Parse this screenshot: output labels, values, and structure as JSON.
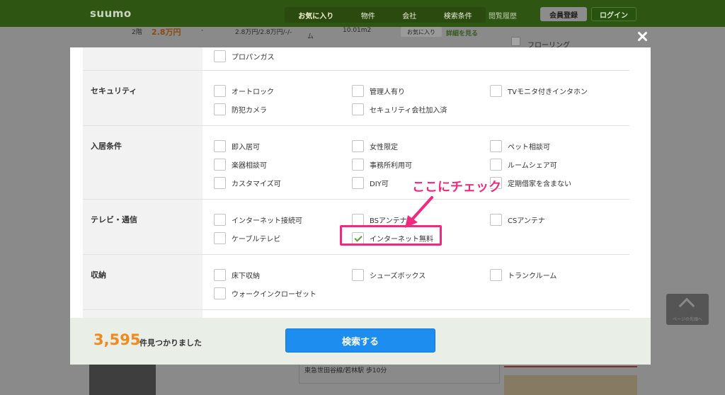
{
  "background": {
    "logo": "suumo",
    "nav": {
      "favorites": "お気に入り",
      "property": "物件",
      "company": "会社",
      "search_conditions": "検索条件",
      "recent": "閲覧履歴",
      "register": "会員登録",
      "login": "ログイン"
    },
    "listing": {
      "floor": "2階",
      "price": "2.8万円",
      "dash": "-",
      "fees": "2.8万円/2.8万円/-/-",
      "layout": "ム",
      "area": "10.01m2",
      "fav_button": "お気に入り",
      "detail_link": "詳細を見る"
    },
    "sidebar_option": "フローリング",
    "station": "東急世田谷線/若林駅 歩10分",
    "page_top": "ページの先頭へ"
  },
  "modal": {
    "rows": [
      {
        "label": "",
        "options": [
          {
            "text": "プロパンガス",
            "checked": false
          }
        ]
      },
      {
        "label": "セキュリティ",
        "options": [
          {
            "text": "オートロック",
            "checked": false
          },
          {
            "text": "管理人有り",
            "checked": false
          },
          {
            "text": "TVモニタ付きインタホン",
            "checked": false
          },
          {
            "text": "防犯カメラ",
            "checked": false
          },
          {
            "text": "セキュリティ会社加入済",
            "checked": false
          }
        ]
      },
      {
        "label": "入居条件",
        "options": [
          {
            "text": "即入居可",
            "checked": false
          },
          {
            "text": "女性限定",
            "checked": false
          },
          {
            "text": "ペット相談可",
            "checked": false
          },
          {
            "text": "楽器相談可",
            "checked": false
          },
          {
            "text": "事務所利用可",
            "checked": false
          },
          {
            "text": "ルームシェア可",
            "checked": false
          },
          {
            "text": "カスタマイズ可",
            "checked": false
          },
          {
            "text": "DIY可",
            "checked": false
          },
          {
            "text": "定期借家を含まない",
            "checked": false
          }
        ]
      },
      {
        "label": "テレビ・通信",
        "options": [
          {
            "text": "インターネット接続可",
            "checked": false
          },
          {
            "text": "BSアンテナ",
            "checked": false
          },
          {
            "text": "CSアンテナ",
            "checked": false
          },
          {
            "text": "ケーブルテレビ",
            "checked": false
          },
          {
            "text": "インターネット無料",
            "checked": true
          }
        ]
      },
      {
        "label": "収納",
        "options": [
          {
            "text": "床下収納",
            "checked": false
          },
          {
            "text": "シューズボックス",
            "checked": false
          },
          {
            "text": "トランクルーム",
            "checked": false
          },
          {
            "text": "ウォークインクローゼット",
            "checked": false
          }
        ]
      },
      {
        "label": "",
        "options": []
      }
    ],
    "footer": {
      "count": "3,595",
      "count_suffix": "件見つかりました",
      "search_button": "検索する"
    }
  },
  "annotation": {
    "callout": "ここにチェック",
    "color": "#f02a7e"
  },
  "colors": {
    "header_dimmed": "#2f5512",
    "count_orange": "#f18a1d",
    "search_blue": "#1d8df0",
    "footer_bg": "#e9eee6"
  }
}
